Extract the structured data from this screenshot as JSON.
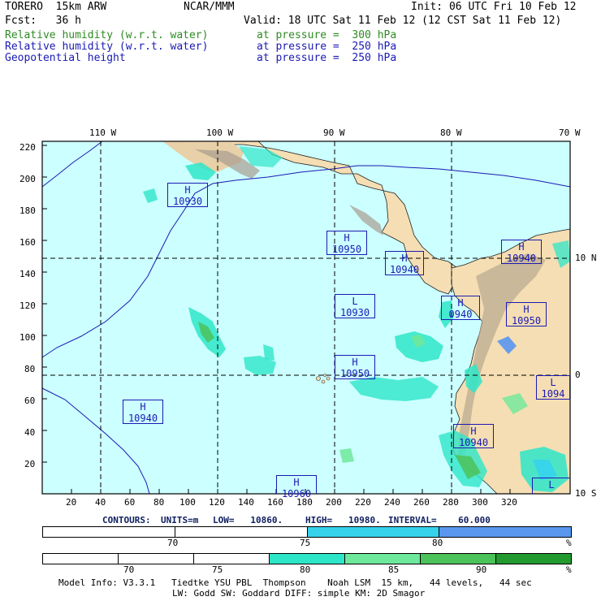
{
  "header": {
    "model": "TORERO  15km ARW",
    "source": "NCAR/MMM",
    "init": "Init: 06 UTC Fri 10 Feb 12",
    "fcst": "Fcst:   36 h",
    "valid": "Valid: 18 UTC Sat 11 Feb 12 (12 CST Sat 11 Feb 12)",
    "fields": [
      {
        "name": "Relative humidity (w.r.t. water)",
        "level": "at pressure =  300 hPa",
        "color": "#2e8b22"
      },
      {
        "name": "Relative humidity (w.r.t. water)",
        "level": "at pressure =  250 hPa",
        "color": "#1a1ab4"
      },
      {
        "name": "Geopotential height",
        "level": "at pressure =  250 hPa",
        "color": "#1a1ab4"
      }
    ]
  },
  "map": {
    "lon_labels": [
      "110 W",
      "100 W",
      "90 W",
      "80 W",
      "70 W"
    ],
    "lat_labels": [
      "10 N",
      "0",
      "10 S"
    ],
    "x_ticks": [
      "20",
      "40",
      "60",
      "80",
      "100",
      "120",
      "140",
      "160",
      "180",
      "200",
      "220",
      "240",
      "260",
      "280",
      "300",
      "320"
    ],
    "y_ticks": [
      "20",
      "40",
      "60",
      "80",
      "100",
      "120",
      "140",
      "160",
      "180",
      "200",
      "220"
    ],
    "centers": [
      {
        "type": "H",
        "value": "10930"
      },
      {
        "type": "H",
        "value": "10950"
      },
      {
        "type": "H",
        "value": "10940"
      },
      {
        "type": "H",
        "value": "10940"
      },
      {
        "type": "L",
        "value": "10930"
      },
      {
        "type": "H",
        "value": "0940"
      },
      {
        "type": "H",
        "value": "10950"
      },
      {
        "type": "H",
        "value": "10950"
      },
      {
        "type": "L",
        "value": "1094"
      },
      {
        "type": "H",
        "value": "10940"
      },
      {
        "type": "H",
        "value": "10940"
      },
      {
        "type": "H",
        "value": "10960"
      },
      {
        "type": "L",
        "value": ""
      }
    ],
    "colors": {
      "ocean": "#ccffff",
      "land": "#f5deb3",
      "contour": "#1a1ab4"
    }
  },
  "contours_line": {
    "label": "CONTOURS:",
    "units": "UNITS=m",
    "low": "LOW=   10860.",
    "high": "HIGH=   10980.",
    "interval": "INTERVAL=    60.000"
  },
  "colorbars": [
    {
      "labels": [
        "70",
        "75",
        "80"
      ],
      "unit": "%",
      "colors": [
        "#ffffff",
        "#ffffff",
        "#36d2ec",
        "#5a96ee"
      ]
    },
    {
      "labels": [
        "70",
        "75",
        "80",
        "85",
        "90"
      ],
      "unit": "%",
      "colors": [
        "#ffffff",
        "#ffffff",
        "#ffffff",
        "#2de6c8",
        "#6ee89a",
        "#4cc25a",
        "#229a30"
      ]
    }
  ],
  "footer": {
    "line1": "Model Info: V3.3.1   Tiedtke YSU PBL  Thompson    Noah LSM  15 km,   44 levels,   44 sec",
    "line2": "LW: Godd SW: Goddard DIFF: simple KM: 2D Smagor"
  }
}
